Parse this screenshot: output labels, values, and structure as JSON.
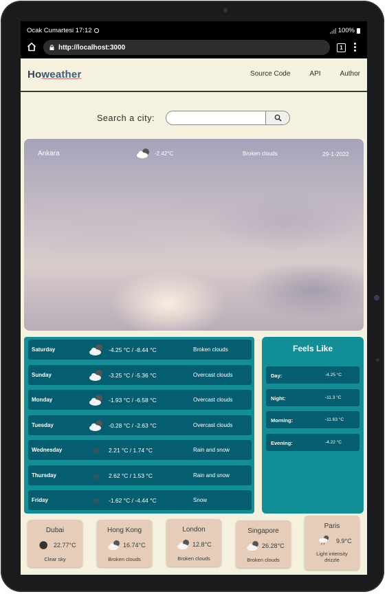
{
  "status_bar": {
    "time": "Ocak Cumartesi 17:12",
    "battery": "100%"
  },
  "browser": {
    "url": "http://localhost:3000",
    "tab_count": "1"
  },
  "nav": {
    "brand_prefix": "Ho",
    "brand_suffix": "weather",
    "links": [
      "Source Code",
      "API",
      "Author"
    ]
  },
  "search": {
    "label": "Search a city:",
    "value": ""
  },
  "current": {
    "city": "Ankara",
    "temp": "-2.42°C",
    "description": "Broken clouds",
    "date": "29-1-2022",
    "icon": "cloud-night-icon"
  },
  "forecast": [
    {
      "day": "Saturday",
      "icon": "cloud-night-icon",
      "temps": "-4.25 °C / -8.44 °C",
      "desc": "Broken clouds"
    },
    {
      "day": "Sunday",
      "icon": "cloud-night-icon",
      "temps": "-3.25 °C / -5.36 °C",
      "desc": "Overcast clouds"
    },
    {
      "day": "Monday",
      "icon": "cloud-night-icon",
      "temps": "-1.93 °C / -6.58 °C",
      "desc": "Overcast clouds"
    },
    {
      "day": "Tuesday",
      "icon": "cloud-night-icon",
      "temps": "-0.28 °C / -2.63 °C",
      "desc": "Overcast clouds"
    },
    {
      "day": "Wednesday",
      "icon": "snow-icon",
      "temps": "2.21 °C / 1.74 °C",
      "desc": "Rain and snow"
    },
    {
      "day": "Thursday",
      "icon": "snow-icon",
      "temps": "2.62 °C / 1.53 °C",
      "desc": "Rain and snow"
    },
    {
      "day": "Friday",
      "icon": "snow-icon",
      "temps": "-1.62 °C / -4.44 °C",
      "desc": "Snow"
    }
  ],
  "feels_like": {
    "title": "Feels Like",
    "rows": [
      {
        "label": "Day:",
        "value": "-4.25 °C"
      },
      {
        "label": "Night:",
        "value": "-11.3 °C"
      },
      {
        "label": "Morning:",
        "value": "-11.63 °C"
      },
      {
        "label": "Evening:",
        "value": "-4.22 °C"
      }
    ]
  },
  "cities": [
    {
      "name": "Dubai",
      "temp": "22.77°C",
      "desc": "Clear sky",
      "icon": "moon-icon"
    },
    {
      "name": "Hong Kong",
      "temp": "16.74°C",
      "desc": "Broken clouds",
      "icon": "cloud-night-icon"
    },
    {
      "name": "London",
      "temp": "12.8°C",
      "desc": "Broken clouds",
      "icon": "cloud-night-icon"
    },
    {
      "name": "Singapore",
      "temp": "26.28°C",
      "desc": "Broken clouds",
      "icon": "cloud-night-icon"
    },
    {
      "name": "Paris",
      "temp": "9.9°C",
      "desc": "Light intensity drizzle",
      "icon": "drizzle-icon"
    }
  ]
}
